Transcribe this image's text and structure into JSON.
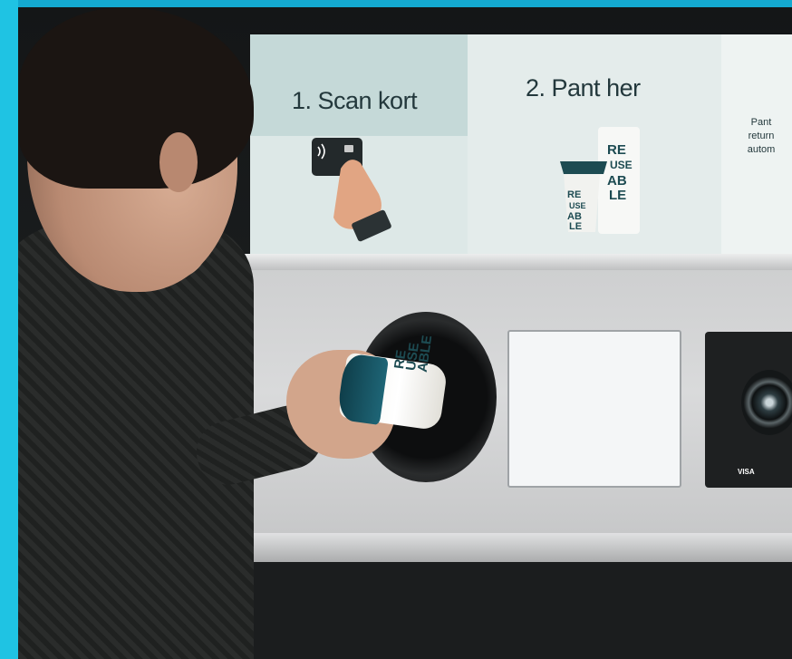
{
  "sign": {
    "step1_title": "1. Scan kort",
    "step2_title": "2. Pant her",
    "step3_text": "Pant\nreturn\nautom"
  },
  "cup_print": "RE\nUSE\nABLE",
  "card_brands": "VISA",
  "colors": {
    "frame": "#1fc3e3",
    "sign_text": "#23383c",
    "brand_teal": "#1d4b52"
  }
}
